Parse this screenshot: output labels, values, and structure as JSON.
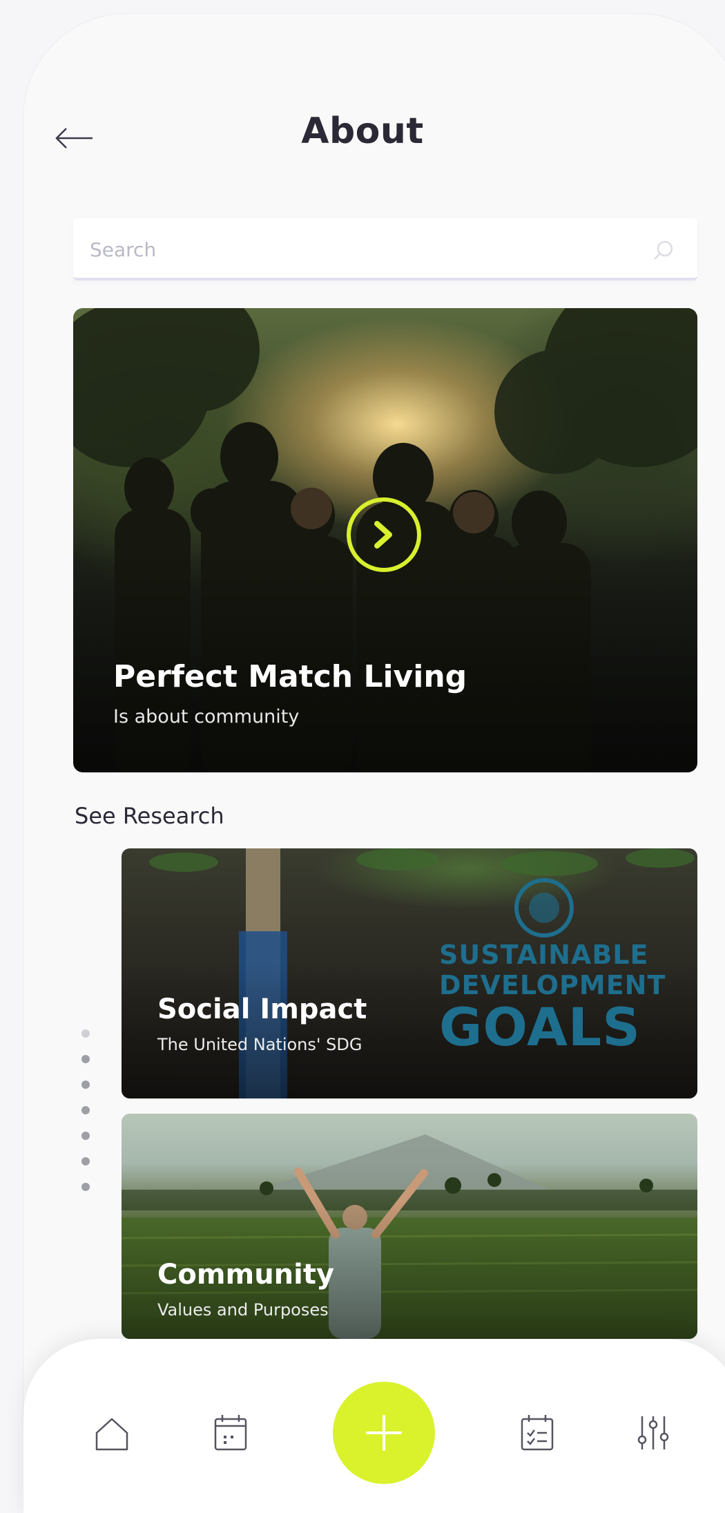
{
  "header": {
    "title": "About",
    "back_icon": "arrow-left-icon"
  },
  "search": {
    "placeholder": "Search",
    "value": "",
    "icon": "search-icon"
  },
  "hero": {
    "title": "Perfect Match Living",
    "subtitle": "Is about community",
    "play_icon": "chevron-right-circle-icon",
    "accent_color": "#d8f02e"
  },
  "research": {
    "label": "See Research",
    "cards": [
      {
        "title": "Social Impact",
        "subtitle": "The United Nations' SDG",
        "logo_text": [
          "SUSTAINABLE",
          "DEVELOPMENT",
          "GOALS"
        ]
      },
      {
        "title": "Community",
        "subtitle": "Values and Purposes"
      }
    ],
    "pagination_count": 7,
    "pagination_active_index": 0
  },
  "nav": {
    "items": [
      "home-icon",
      "calendar-icon",
      "add-icon",
      "checklist-icon",
      "filter-icon"
    ],
    "fab_color": "#d9f22c"
  }
}
